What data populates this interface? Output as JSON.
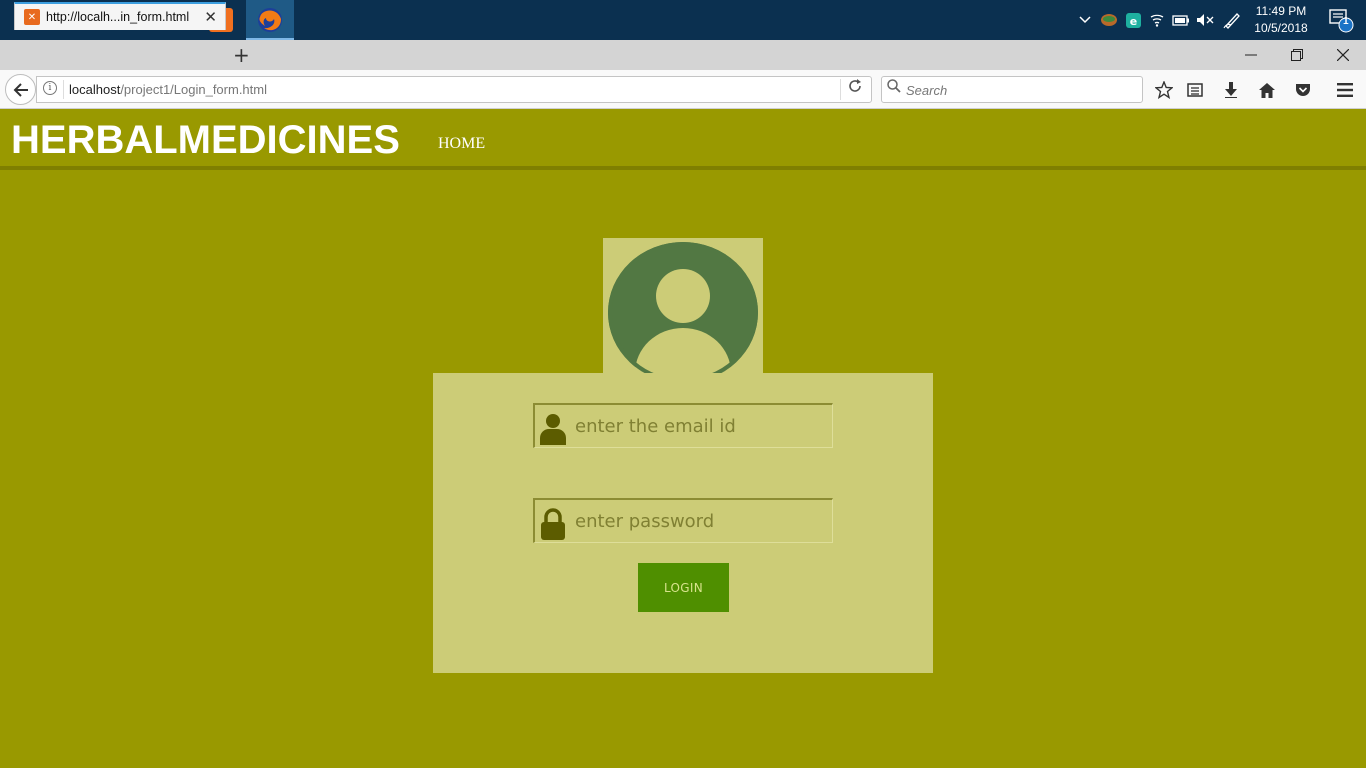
{
  "taskbar": {
    "clock_time": "11:49 PM",
    "clock_date": "10/5/2018",
    "notification_count": "1"
  },
  "browser": {
    "tab_title": "http://localh...in_form.html",
    "url_host": "localhost",
    "url_path": "/project1/Login_form.html",
    "search_placeholder": "Search"
  },
  "site": {
    "logo": "HERBALMEDICINES",
    "nav": {
      "home_label": "HOME"
    }
  },
  "login_form": {
    "email_placeholder": "enter the email id",
    "password_placeholder": "enter password",
    "login_label": "LOGIN"
  },
  "colors": {
    "page_bg": "#999900",
    "form_bg": "#cccc77",
    "avatar_color": "#527843",
    "button_bg": "#4f8f00"
  }
}
